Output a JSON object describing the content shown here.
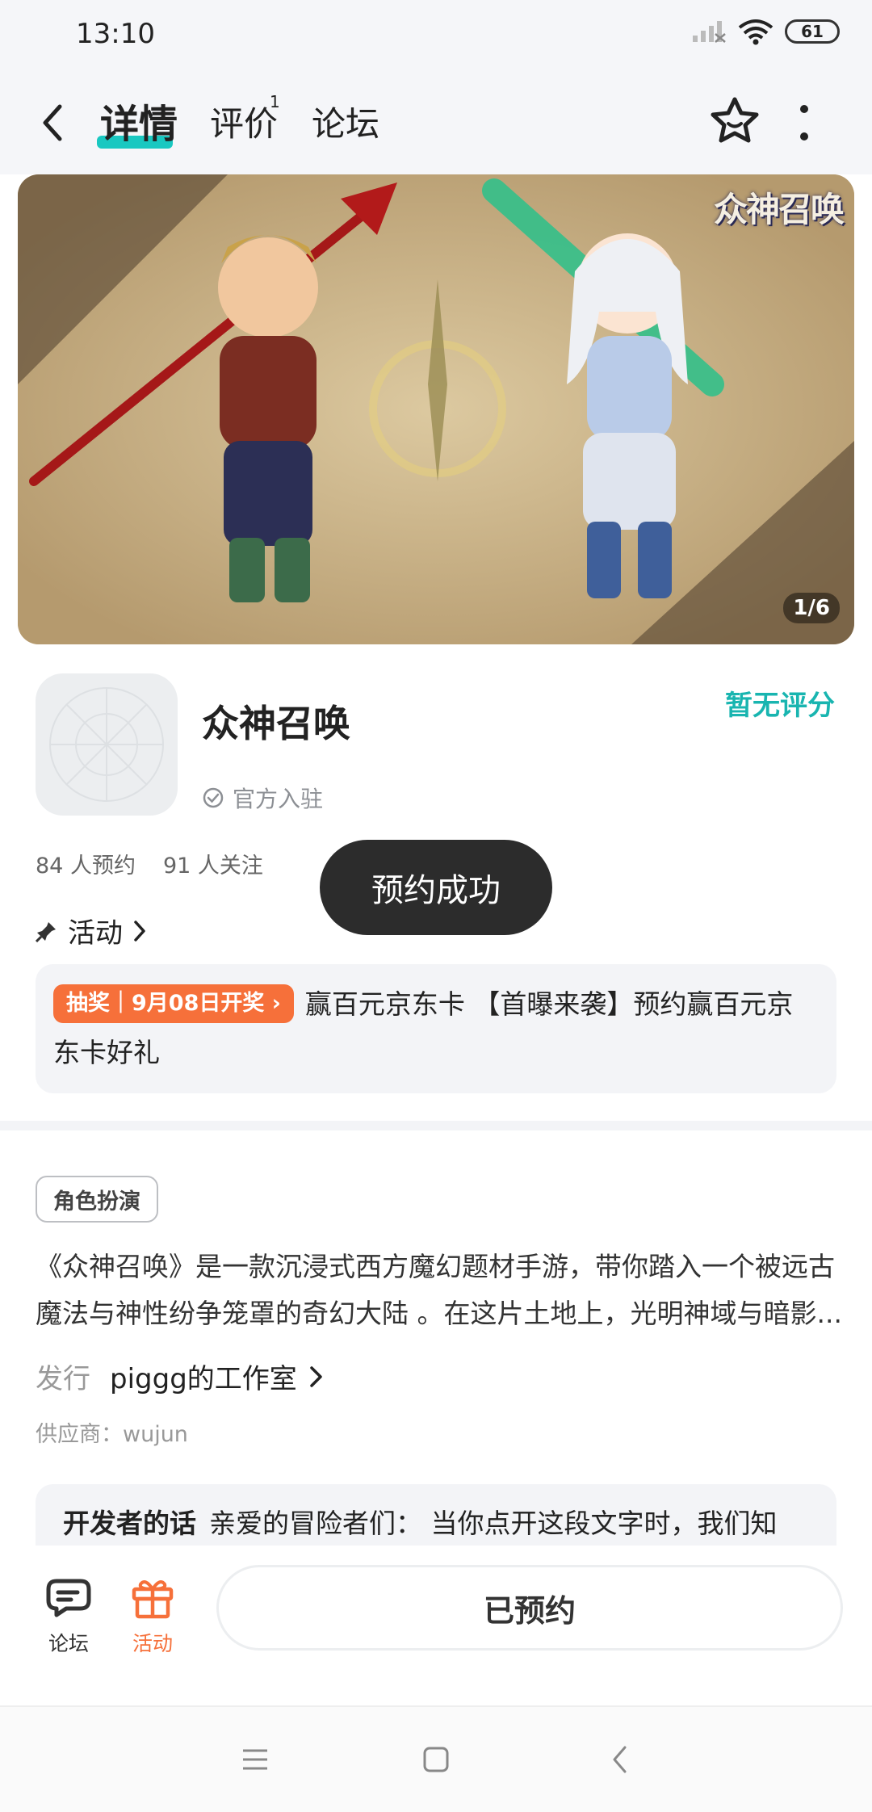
{
  "status_bar": {
    "time": "13:10",
    "battery": "61"
  },
  "header": {
    "tabs": [
      {
        "label": "详情",
        "active": true
      },
      {
        "label": "评价",
        "badge": "1"
      },
      {
        "label": "论坛"
      }
    ]
  },
  "banner": {
    "logo_text": "众神召唤",
    "counter": "1/6"
  },
  "app": {
    "name": "众神召唤",
    "rating": "暂无评分",
    "official_label": "官方入驻",
    "stats": {
      "reservations": "84 人预约",
      "followers": "91 人关注"
    }
  },
  "toast": "预约成功",
  "activity": {
    "section_label": "活动",
    "badge": "抽奖｜9月08日开奖",
    "text": "赢百元京东卡 【首曝来袭】预约赢百元京东卡好礼"
  },
  "details": {
    "tag": "角色扮演",
    "description": "《众神召唤》是一款沉浸式西方魔幻题材手游，带你踏入一个被远古魔法与神性纷争笼罩的奇幻大陆 。在这片土地上，光明神域与暗影...",
    "publisher_label": "发行",
    "publisher": "piggg的工作室",
    "supplier": "供应商：wujun",
    "dev_title": "开发者的话",
    "dev_text": "亲爱的冒险者们： 当你点开这段文字时，我们知"
  },
  "bottom_bar": {
    "forum_label": "论坛",
    "activity_label": "活动",
    "reserve_button": "已预约"
  },
  "colors": {
    "accent": "#19c8c1",
    "rating": "#19b5b0",
    "orange": "#f6703a"
  }
}
